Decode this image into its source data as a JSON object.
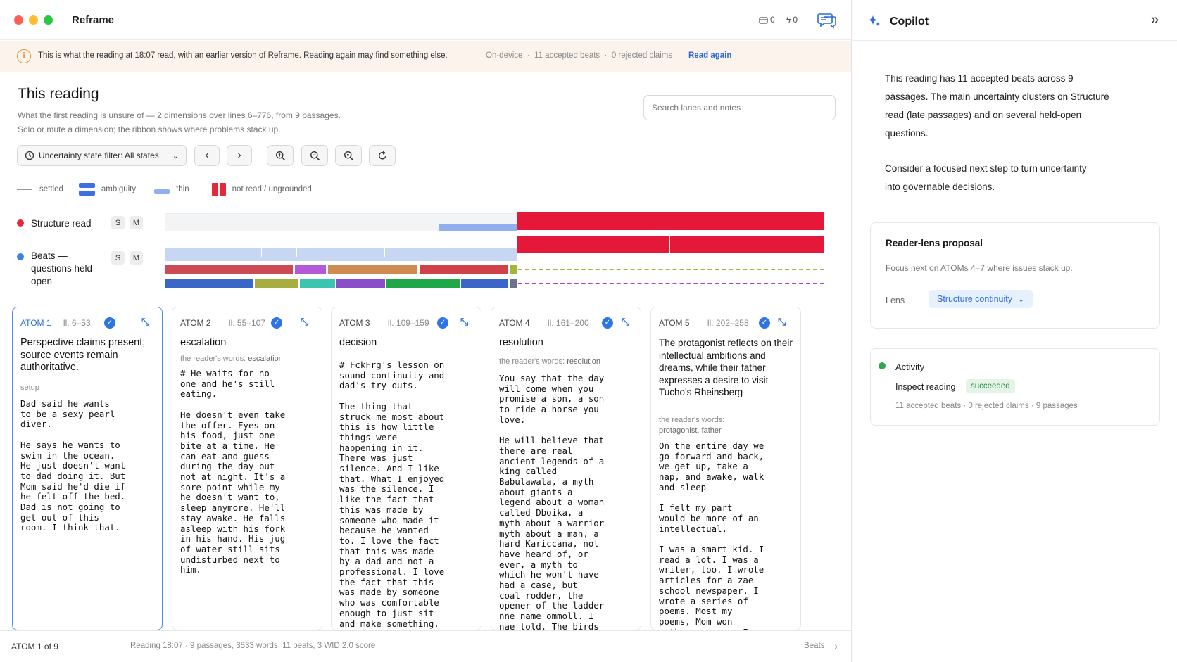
{
  "window": {
    "app_title": "Reframe",
    "counter_a": "0",
    "counter_b": "0"
  },
  "notice": {
    "message": "This is what the reading at 18:07 read, with an earlier version of Reframe. Reading again may find something else.",
    "meta_device": "On-device",
    "meta_beats": "11 accepted beats",
    "meta_claims": "0 rejected claims",
    "action": "Read again"
  },
  "main": {
    "title": "This reading",
    "subtitle_1": "What the first reading is unsure of — 2 dimensions over lines 6–776, from 9 passages.",
    "subtitle_2": "Solo or mute a dimension; the ribbon shows where problems stack up.",
    "search_placeholder": "Search lanes and notes",
    "filter_label": "Uncertainty state filter: All states"
  },
  "legend": {
    "settled": "settled",
    "ambiguity": "ambiguity",
    "thin": "thin",
    "not_read": "not read / ungrounded"
  },
  "lanes": [
    {
      "label": "Structure read",
      "solo": "S",
      "mute": "M",
      "color": "#e5283a"
    },
    {
      "label": "Beats — questions held open",
      "solo": "S",
      "mute": "M",
      "color": "#3b82e8"
    }
  ],
  "cards": [
    {
      "atom": "ATOM 1",
      "lines": "ll. 6–53",
      "title": "Perspective claims present; source events remain authoritative.",
      "words_label": "setup",
      "words": "",
      "body": "Dad said he wants\nto be a sexy pearl\ndiver.\n\nHe says he wants to\nswim in the ocean.\nHe just doesn't want\nto dad doing it. But\nMom said he'd die if\nhe felt off the bed.\nDad is not going to\nget out of this\nroom. I think that."
    },
    {
      "atom": "ATOM 2",
      "lines": "ll. 55–107",
      "title": "escalation",
      "words_label": "the reader's words:",
      "words": "escalation",
      "body": "# He waits for no\none and he's still\neating.\n\nHe doesn't even take\nthe offer. Eyes on\nhis food, just one\nbite at a time. He\ncan eat and guess\nduring the day but\nnot at night. It's a\nsore point while my\nhe doesn't want to,\nsleep anymore. He'll\nstay awake. He falls\nasleep with his fork\nin his hand. His jug\nof water still sits\nundisturbed next to\nhim."
    },
    {
      "atom": "ATOM 3",
      "lines": "ll. 109–159",
      "title": "decision",
      "words_label": "",
      "words": "",
      "body": "# FckFrg's lesson on\nsound continuity and\ndad's try outs.\n\nThe thing that\nstruck me most about\nthis is how little\nthings were\nhappening in it.\nThere was just\nsilence. And I like\nthat. What I enjoyed\nwas the silence. I\nlike the fact that\nthis was made by\nsomeone who made it\nbecause he wanted\nto. I love the fact\nthat this was made\nby a dad and not a\nprofessional. I love\nthe fact that this\nwas made by someone\nwho was comfortable\nenough to just sit\nand make something."
    },
    {
      "atom": "ATOM 4",
      "lines": "ll. 161–200",
      "title": "resolution",
      "words_label": "the reader's words:",
      "words": "resolution",
      "body": "You say that the day\nwill come when you\npromise a son, a son\nto ride a horse you\nlove.\n\nHe will believe that\nthere are real\nancient legends of a\nking called\nBabulawala, a myth\nabout giants a\nlegend about a woman\ncalled Dboika, a\nmyth about a warrior\nmyth about a man, a\nhard Kariccana, not\nhave heard of, or\never, a myth to\nwhich he won't have\nhad a case, but\ncoal rodder, the\nopener of the ladder\nnne name ommoll. I\nnae told. The birds"
    },
    {
      "atom": "ATOM 5",
      "lines": "ll. 202–258",
      "title": "The protagonist reflects on their intellectual ambitions and dreams, while their father expresses a desire to visit Tucho's Rheinsberg",
      "words_label": "the reader's words:",
      "words": "protagonist, father",
      "body": "On the entire day we\ngo forward and back,\nwe get up, take a\nnap, and awake, walk\nand sleep\n\nI felt my part\nwould be more of an\nintellectual.\n\nI was a smart kid. I\nread a lot. I was a\nwriter, too. I wrote\narticles for a zae\nschool newspaper. I\nwrote a series of\npoems. Most my\npoems, Mom won\nnothe; oy oac … I"
    }
  ],
  "footer": {
    "position": "ATOM 1 of 9",
    "summary": "Reading 18:07 · 9 passages, 3533 words, 11 beats, 3 WID 2.0 score",
    "nav": "Beats"
  },
  "copilot": {
    "title": "Copilot",
    "paragraph_1": "This reading has 11 accepted beats across 9 passages. The main uncertainty clusters on Structure read (late passages) and on several held-open questions.",
    "paragraph_2": "Consider a focused next step to turn uncertainty into governable decisions.",
    "proposal_title": "Reader-lens proposal",
    "proposal_text": "Focus next on ATOMs 4–7 where issues stack up.",
    "lens_label": "Lens",
    "lens_value": "Structure continuity",
    "activity_title": "Activity",
    "activity_item": "Inspect reading",
    "activity_status": "succeeded",
    "activity_meta": "11 accepted beats · 0 rejected claims · 9 passages"
  },
  "colors": {
    "accent": "#2b6cd8",
    "structure": "#e5283a",
    "beats": "#3b82e8",
    "success": "#2fa84f"
  }
}
